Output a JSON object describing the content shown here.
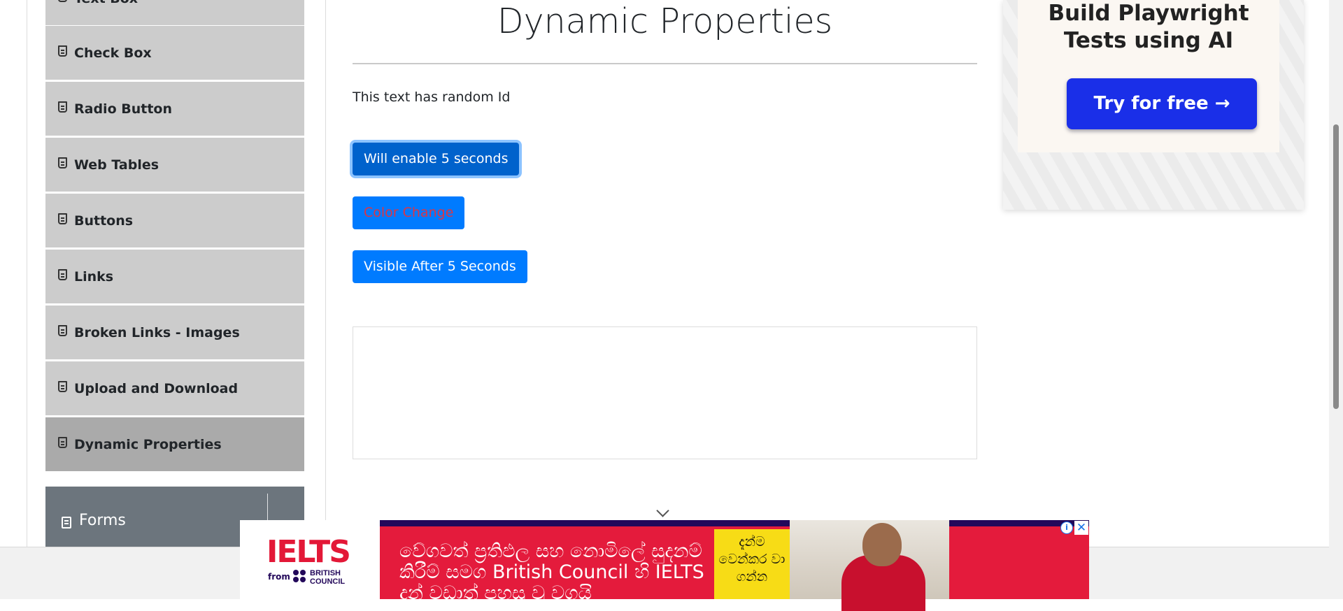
{
  "sidebar": {
    "items": [
      {
        "label": "Text Box"
      },
      {
        "label": "Check Box"
      },
      {
        "label": "Radio Button"
      },
      {
        "label": "Web Tables"
      },
      {
        "label": "Buttons"
      },
      {
        "label": "Links"
      },
      {
        "label": "Broken Links - Images"
      },
      {
        "label": "Upload and Download"
      },
      {
        "label": "Dynamic Properties",
        "active": true
      }
    ],
    "forms_group": {
      "label": "Forms"
    }
  },
  "main": {
    "title": "Dynamic Properties",
    "random_id_text": "This text has random Id",
    "buttons": {
      "enable_after": "Will enable 5 seconds",
      "color_change": "Color Change",
      "visible_after": "Visible After 5 Seconds"
    }
  },
  "right_ad": {
    "headline": "Build Playwright Tests using AI",
    "cta": "Try for free →"
  },
  "bottom_ad": {
    "logo": "IELTS",
    "from": "from",
    "partner": "BRITISH COUNCIL",
    "text": "වේගවත් ප්‍රතිඵල සහ නොමිලේ සුදනම් කිරීම් සමග British Council හි IELTS දැන් වඩාත් පහසු වූ වගයි",
    "cta": "දැන්ම වෙන්කර වා ගන්න",
    "adchoices": "i",
    "close": "✕"
  },
  "colors": {
    "primary": "#007bff",
    "sidebar_item": "#cccccc",
    "sidebar_active": "#aaaaaa",
    "forms_group": "#6c757d",
    "color_change_text": "#dc3545"
  }
}
